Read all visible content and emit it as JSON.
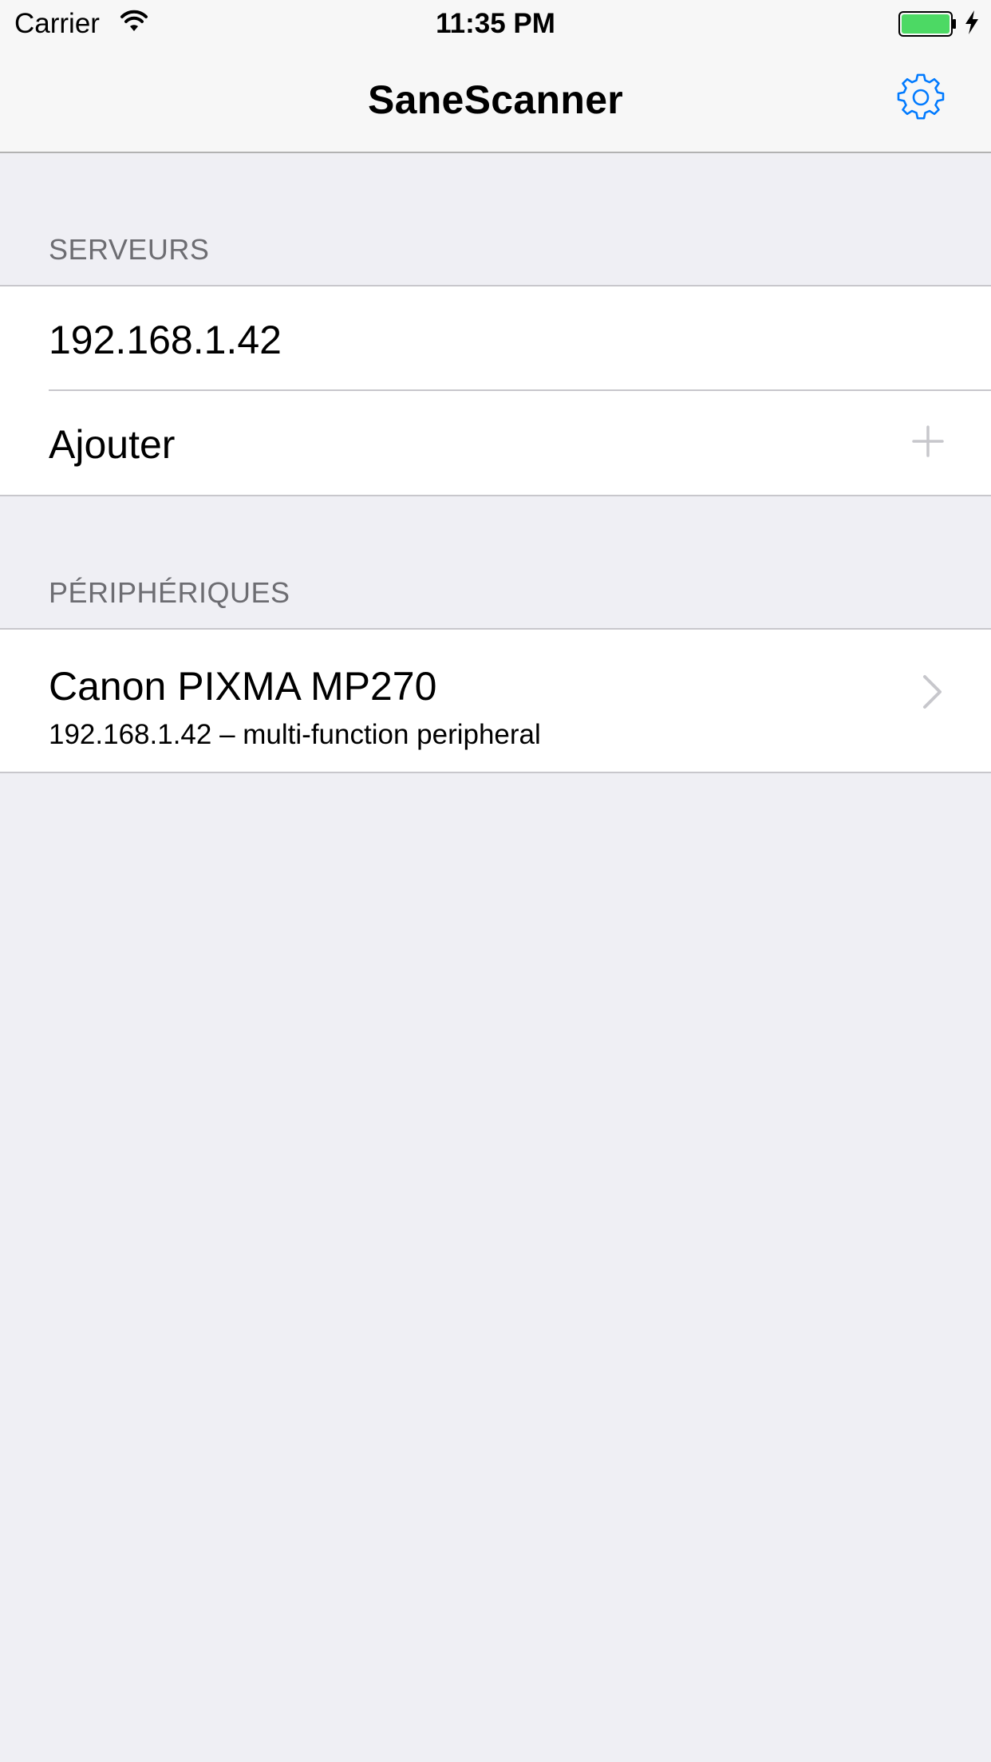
{
  "status_bar": {
    "carrier": "Carrier",
    "time": "11:35 PM",
    "battery_color": "#4cd964"
  },
  "nav": {
    "title": "SaneScanner",
    "settings_icon": "gear-icon",
    "accent_color": "#007aff"
  },
  "sections": {
    "servers": {
      "header": "SERVEURS",
      "items": [
        {
          "label": "192.168.1.42"
        }
      ],
      "add_label": "Ajouter",
      "add_icon": "plus-icon"
    },
    "devices": {
      "header": "PÉRIPHÉRIQUES",
      "items": [
        {
          "title": "Canon PIXMA MP270",
          "subtitle": "192.168.1.42 – multi-function peripheral",
          "accessory_icon": "chevron-right-icon"
        }
      ]
    }
  }
}
